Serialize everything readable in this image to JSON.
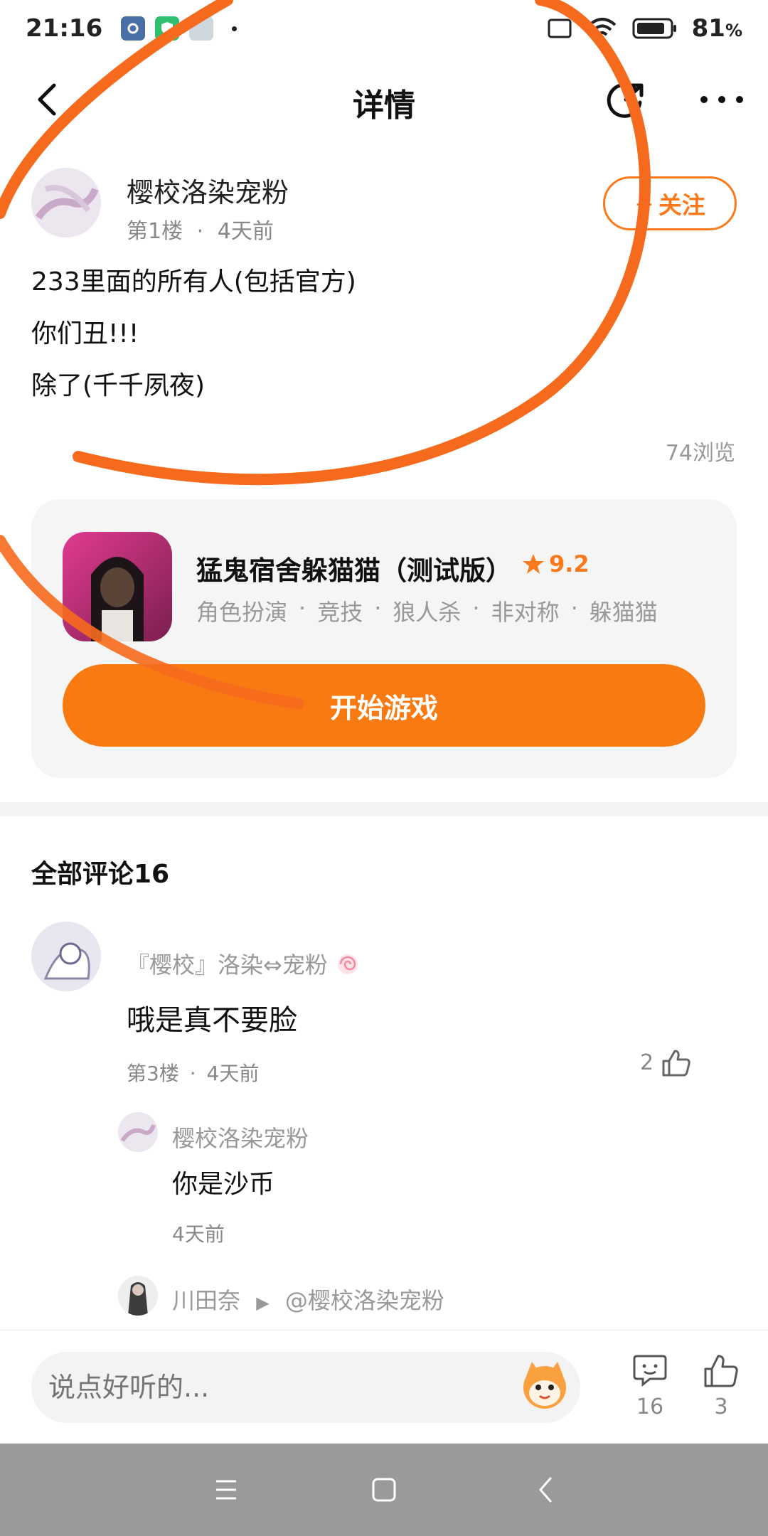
{
  "status_bar": {
    "time": "21:16",
    "battery": "81"
  },
  "header": {
    "title": "详情"
  },
  "post": {
    "author": "樱校洛染宠粉",
    "floor": "第1楼",
    "time_ago": "4天前",
    "follow_label": "关注",
    "lines": [
      "233里面的所有人(包括官方)",
      "你们丑!!!",
      "除了(千千夙夜)"
    ],
    "views": "74浏览"
  },
  "game": {
    "title": "猛鬼宿舍躲猫猫（测试版）",
    "rating": "9.2",
    "tags": [
      "角色扮演",
      "竞技",
      "狼人杀",
      "非对称",
      "躲猫猫"
    ],
    "start_label": "开始游戏"
  },
  "comments": {
    "title": "全部评论16",
    "items": [
      {
        "author": "『樱校』洛染⇔宠粉",
        "text": "哦是真不要脸",
        "floor": "第3楼",
        "time_ago": "4天前",
        "likes": "2"
      }
    ],
    "replies": [
      {
        "author": "樱校洛染宠粉",
        "text": "你是沙币",
        "time_ago": "4天前"
      },
      {
        "author": "川田奈",
        "mention": "@樱校洛染宠粉"
      }
    ]
  },
  "bottom_bar": {
    "input_placeholder": "说点好听的...",
    "comment_count": "16",
    "like_count": "3"
  },
  "colors": {
    "accent": "#fa7a12",
    "scribble": "#f66a1d"
  }
}
